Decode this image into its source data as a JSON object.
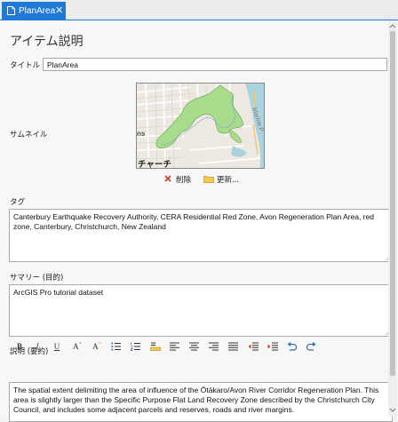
{
  "tab": {
    "label": "PlanArea",
    "close": "✕"
  },
  "heading": "アイテム説明",
  "title_field": {
    "label": "タイトル",
    "value": "PlanArea"
  },
  "thumbnail": {
    "label": "サムネイル",
    "map_text_left": "ns",
    "map_text_bottom": "チャーチ",
    "map_text_right": "Marine P"
  },
  "thumbnail_actions": {
    "delete": "削除",
    "update": "更新..."
  },
  "tags": {
    "label": "タグ",
    "value": "Canterbury Earthquake Recovery Authority, CERA Residential Red Zone, Avon Regeneration Plan Area, red zone, Canterbury, Christchurch, New Zealand"
  },
  "summary": {
    "label": "サマリー (目的)",
    "value": "ArcGIS Pro tutorial dataset"
  },
  "description": {
    "label": "説明 (要約)",
    "value": "The spatial extent delimiting the area of influence of the Ōtākaro/Avon River Corridor Regeneration Plan. This area is slightly larger than the Specific Purpose Flat Land Recovery Zone described by the Christchurch City Council, and includes some adjacent parcels and reserves, roads and river margins."
  },
  "toolbar": {
    "bold": "B",
    "italic": "I",
    "underline": "U",
    "grow": "A",
    "shrink": "A"
  },
  "colors": {
    "accent": "#1e7ad6",
    "map_green": "#a8dc8c",
    "map_water": "#aad3df",
    "delete_red": "#d23b2b"
  },
  "icons": {
    "tab": "document-icon",
    "delete": "x-icon",
    "update": "folder-icon",
    "toolbar": [
      "bold",
      "italic",
      "underline",
      "font-grow",
      "font-shrink",
      "bullet-list",
      "numbered-list",
      "highlight",
      "align-left",
      "align-center",
      "align-right",
      "justify",
      "outdent",
      "indent",
      "undo",
      "redo"
    ]
  }
}
